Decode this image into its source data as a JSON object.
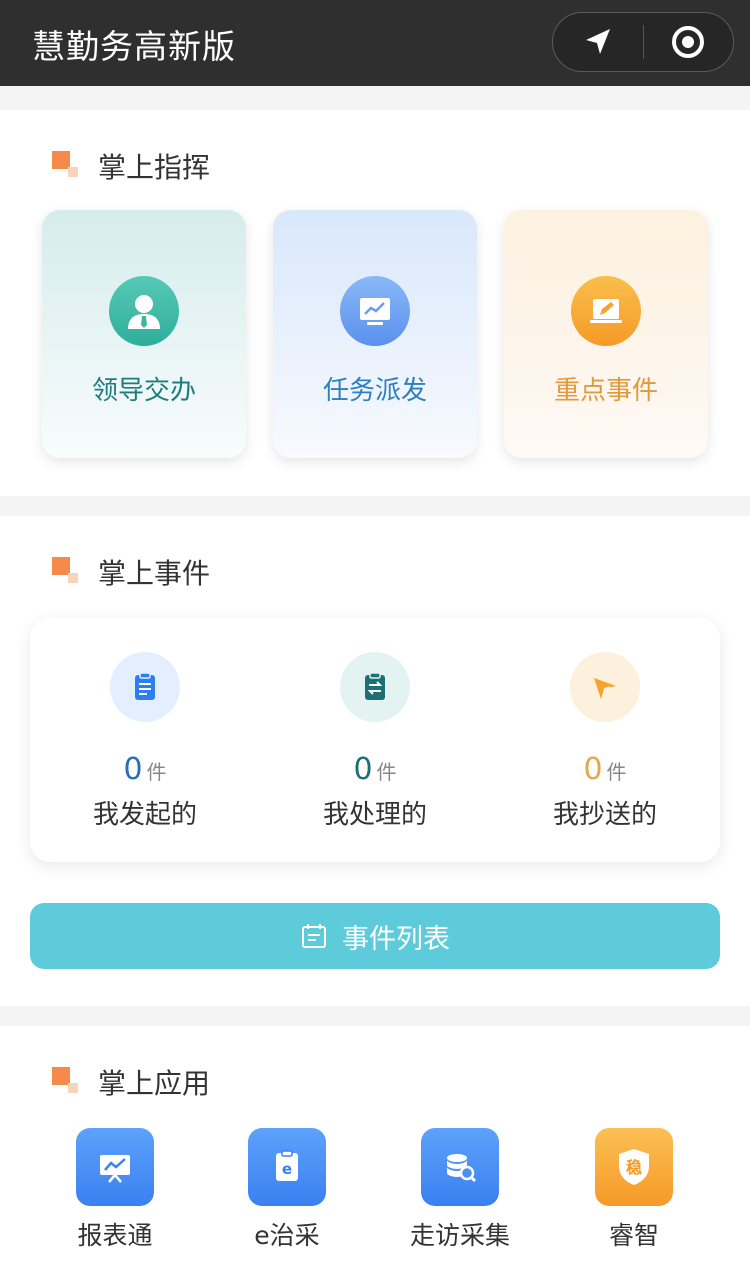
{
  "app": {
    "title": "慧勤务高新版"
  },
  "command": {
    "title": "掌上指挥",
    "tiles": [
      {
        "label": "领导交办",
        "icon": "leader-person-icon"
      },
      {
        "label": "任务派发",
        "icon": "presentation-chart-icon"
      },
      {
        "label": "重点事件",
        "icon": "edit-laptop-icon"
      }
    ]
  },
  "events": {
    "title": "掌上事件",
    "unit": "件",
    "stats": [
      {
        "count": "0",
        "label": "我发起的",
        "color": "#2a6fb4",
        "icon": "clipboard-icon"
      },
      {
        "count": "0",
        "label": "我处理的",
        "color": "#1d6f73",
        "icon": "exchange-clipboard-icon"
      },
      {
        "count": "0",
        "label": "我抄送的",
        "color": "#e5a94a",
        "icon": "send-icon"
      }
    ],
    "list_button": "事件列表"
  },
  "apps": {
    "title": "掌上应用",
    "items": [
      {
        "label": "报表通",
        "icon": "report-chart-icon"
      },
      {
        "label": "e治采",
        "icon": "e-clipboard-icon"
      },
      {
        "label": "走访采集",
        "icon": "database-search-icon"
      },
      {
        "label": "睿智",
        "icon": "shield-icon",
        "badge": "稳"
      }
    ]
  },
  "colors": {
    "accent_orange": "#f58a4b",
    "event_button": "#5ecbdb",
    "topbar": "#2f2f2f"
  }
}
